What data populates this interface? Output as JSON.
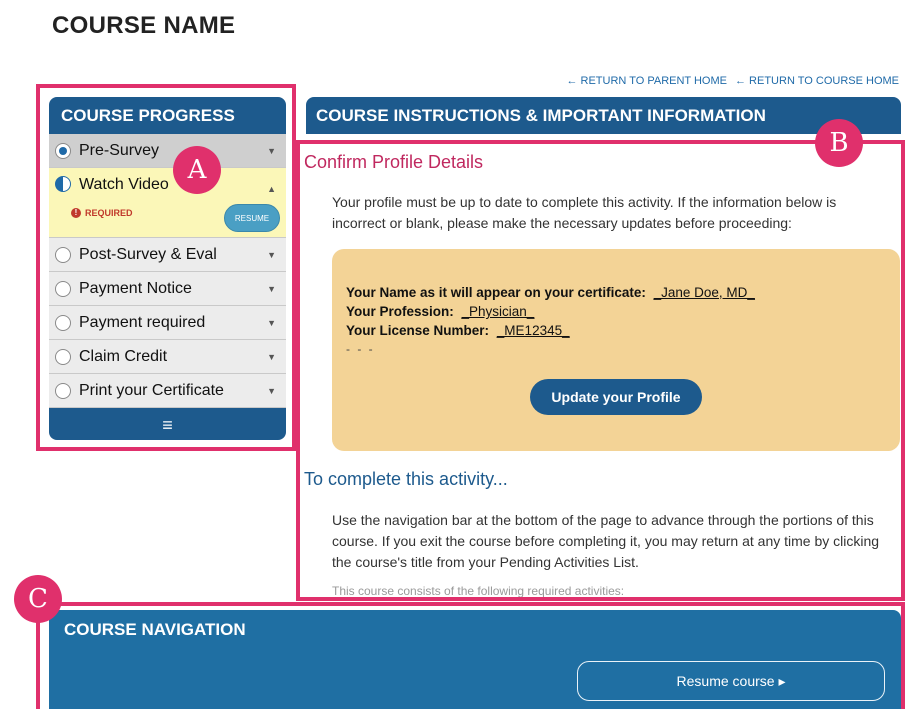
{
  "course_name": "COURSE NAME",
  "top_links": {
    "parent_home": "← RETURN TO PARENT HOME",
    "course_home": "← RETURN TO COURSE HOME"
  },
  "annotations": {
    "a": "A",
    "b": "B",
    "c": "C"
  },
  "progress": {
    "title": "COURSE PROGRESS",
    "items": [
      {
        "label": "Pre-Survey"
      },
      {
        "label": "Watch Video",
        "required": "REQUIRED",
        "resume": "RESUME"
      },
      {
        "label": "Post-Survey & Eval"
      },
      {
        "label": "Payment Notice"
      },
      {
        "label": "Payment required"
      },
      {
        "label": "Claim Credit"
      },
      {
        "label": "Print your Certificate"
      }
    ],
    "menu_icon": "≡"
  },
  "instructions": {
    "title": "COURSE INSTRUCTIONS & IMPORTANT INFORMATION",
    "confirm_heading": "Confirm Profile Details",
    "confirm_text": "Your profile must be up to date to complete this activity. If the information below is incorrect or blank, please make the necessary updates before proceeding:",
    "name_label": "Your Name as it will appear on your certificate:",
    "name_value": "_Jane Doe, MD_",
    "profession_label": "Your Profession:",
    "profession_value": "_Physician_",
    "license_label": "Your License Number:",
    "license_value": "_ME12345_",
    "dashes": "- - -",
    "update_button": "Update your Profile",
    "complete_heading": "To complete this activity...",
    "complete_text": "Use the navigation bar at the bottom of the page to advance through the portions of this course. If you exit the course before completing it, you may return at any time by clicking the course's title from your Pending Activities List.",
    "faded_text": "This course consists of the following required activities:"
  },
  "navigation": {
    "title": "COURSE NAVIGATION",
    "resume_button": "Resume course ▸"
  },
  "colors": {
    "primary": "#1d5a8d",
    "nav": "#1f6fa3",
    "accent": "#e0306c",
    "profile_box": "#f3d396"
  }
}
